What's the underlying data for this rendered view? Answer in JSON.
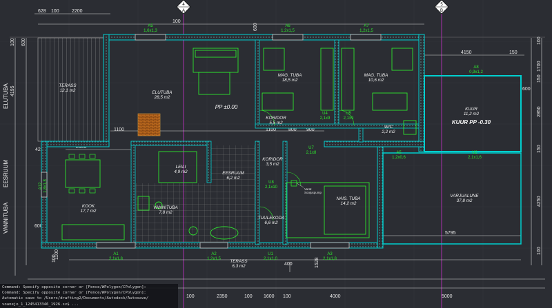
{
  "app": {
    "colors": {
      "background": "#2b2d33",
      "wall": "#00c8c8",
      "furniture": "#2ee62e",
      "dim": "#e0e0e0",
      "grid_axis": "#cc33cc",
      "hatch": "#d98c1a",
      "window": "#d0d0d0"
    }
  },
  "axes": {
    "A": {
      "top": "4",
      "bottom": "A"
    },
    "B": {
      "top": "5",
      "bottom": "B"
    }
  },
  "dims_top": [
    "628",
    "100",
    "2200"
  ],
  "dims_bottom": [
    "100",
    "2350",
    "100",
    "1600",
    "100",
    "4000",
    "5000"
  ],
  "dims_right": [
    "100",
    "1700",
    "150",
    "2850",
    "150",
    "4250",
    "100"
  ],
  "dims_left": [
    "100",
    "600",
    "4195",
    "1100",
    "600",
    "100"
  ],
  "dims_inner": [
    "100",
    "600",
    "4150",
    "150",
    "600",
    "1100",
    "1100",
    "800",
    "900",
    "2300",
    "423",
    "5795",
    "400",
    "1528"
  ],
  "side_labels": {
    "top": "ELUTUBA",
    "mid": "EESRUUM",
    "bottom": "VANNITUBA"
  },
  "rooms": [
    {
      "name": "TERASS",
      "area": "12,1 m2"
    },
    {
      "name": "ELUTUBA",
      "area": "28,5 m2"
    },
    {
      "name": "MAG. TUBA",
      "area": "18,5 m2"
    },
    {
      "name": "MAG. TUBA",
      "area": "10,6 m2"
    },
    {
      "name": "KORIDOR",
      "area": "5,5 m2"
    },
    {
      "name": "KUUR",
      "area": "11,2 m2"
    },
    {
      "name": "W/C",
      "area": "2,2 m2"
    },
    {
      "name": "KORIDOR",
      "area": "3,5 m2"
    },
    {
      "name": "EESRUUM",
      "area": "6,2 m2"
    },
    {
      "name": "NAIS. TUBA",
      "area": "14,2 m2"
    },
    {
      "name": "VARJUALUNE",
      "area": "37,8 m2"
    },
    {
      "name": "KOOK",
      "area": "17,7 m2"
    },
    {
      "name": "VANNITUBA",
      "area": "7,8 m2"
    },
    {
      "name": "TUULEKODA",
      "area": "6,6 m2"
    },
    {
      "name": "LEILI",
      "area": "4,9 m2"
    },
    {
      "name": "TERASS",
      "area": "6,3 m2"
    }
  ],
  "levels": {
    "main": "PP ±0.00",
    "shed": "KUUR PP -0.30"
  },
  "windows": [
    {
      "tag": "A5",
      "size": "1,6x1,3"
    },
    {
      "tag": "A6",
      "size": "1,2x1,5"
    },
    {
      "tag": "A7",
      "size": "1,2x1,5"
    },
    {
      "tag": "A8",
      "size": "0,9x1,2"
    },
    {
      "tag": "A12",
      "size": "1,8x1,8"
    },
    {
      "tag": "A5",
      "size": "1,2x0,6"
    },
    {
      "tag": "A1",
      "size": "2,1x1,8"
    },
    {
      "tag": "A3",
      "size": "2,1x1,8"
    },
    {
      "tag": "A2",
      "size": "1,2x1,5"
    }
  ],
  "doors": [
    {
      "tag": "U4",
      "size": "2,1x9"
    },
    {
      "tag": "U5",
      "size": "2,1x9"
    },
    {
      "tag": "U7",
      "size": "2,1x8"
    },
    {
      "tag": "U8",
      "size": "2,1x10"
    },
    {
      "tag": "U2",
      "size": "2,1x1,6"
    },
    {
      "tag": "U1",
      "size": "2,1x1,0"
    }
  ],
  "note": {
    "line1": "Varat",
    "line2": "Soojuspump"
  },
  "command_line": [
    "Command: Specify opposite corner or [Fence/WPolygon/CPolygon]:",
    "Command: Specify opposite corner or [Fence/WPolygon/CPolygon]:",
    "Automatic save to /Users/drafting2/Documents/Autodesk/Autosave/",
    "voanejo_1_1245413346_1926.sv$ ..."
  ]
}
